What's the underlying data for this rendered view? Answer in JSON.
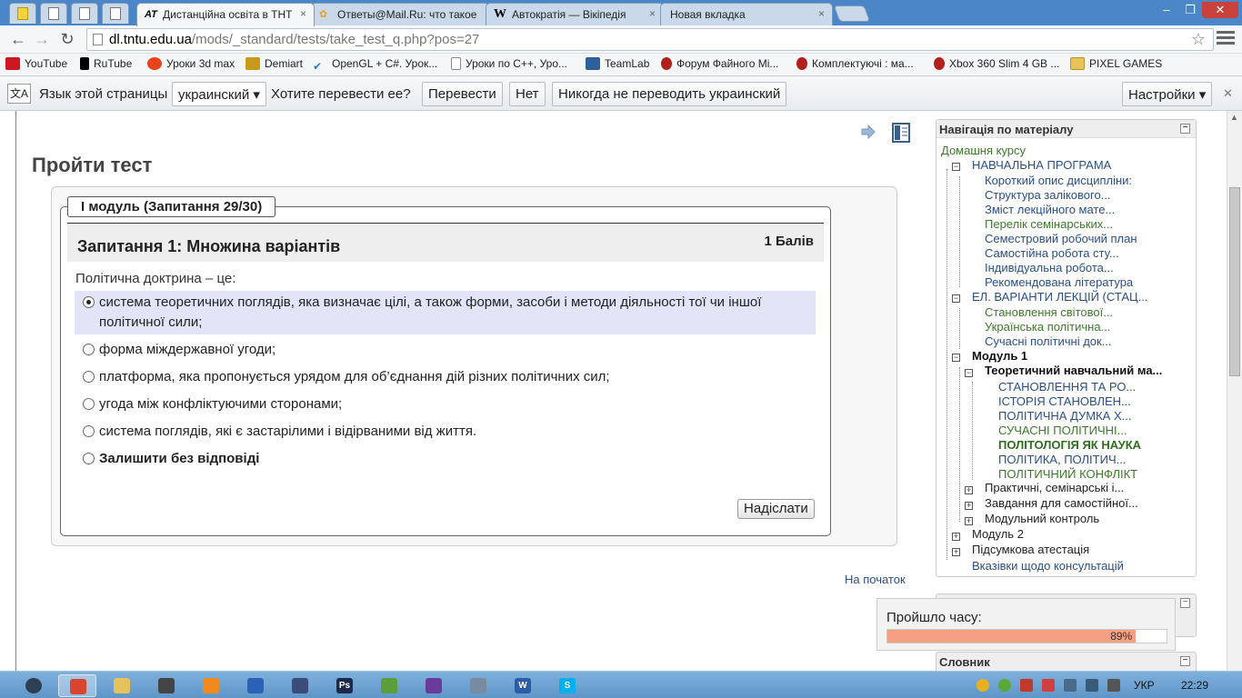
{
  "tabs": [
    {
      "title": "Дистанційна освіта в ТНТ",
      "icon": "AT",
      "active": true
    },
    {
      "title": "Ответы@Mail.Ru: что такое",
      "icon": "mailru-icon",
      "active": false
    },
    {
      "title": "Автократія — Вікіпедія",
      "icon": "W",
      "active": false
    },
    {
      "title": "Новая вкладка",
      "icon": "",
      "active": false
    }
  ],
  "tab_close": "×",
  "window_controls": {
    "minimize": "–",
    "restore": "❐",
    "close": "✕"
  },
  "address": {
    "host": "dl.tntu.edu.ua",
    "path": "/mods/_standard/tests/take_test_q.php?pos=27"
  },
  "nav_glyphs": {
    "back": "←",
    "forward": "→",
    "reload": "↻",
    "star": "☆"
  },
  "bookmarks": [
    {
      "label": "YouTube",
      "color": "#cc181e"
    },
    {
      "label": "RuTube",
      "color": "#000000"
    },
    {
      "label": "Уроки 3d max",
      "color": "#e8431c"
    },
    {
      "label": "Demiart",
      "color": "#c79a1a"
    },
    {
      "label": "OpenGL + C#. Урок...",
      "color": "#2a7ad6"
    },
    {
      "label": "Уроки по C++, Уро...",
      "color": "#ffffff"
    },
    {
      "label": "TeamLab",
      "color": "#2d5f9a"
    },
    {
      "label": "Форум Файного Мі...",
      "color": "#b3201c"
    },
    {
      "label": "Комплектуючі : ма...",
      "color": "#b3201c"
    },
    {
      "label": "Xbox 360 Slim 4 GB ...",
      "color": "#b3201c"
    },
    {
      "label": "PIXEL GAMES",
      "color": "#e8c35a"
    }
  ],
  "translate_bar": {
    "icon_label": "文A",
    "page_language_label": "Язык этой страницы",
    "language": "украинский ▾",
    "question": "Хотите перевести ее?",
    "translate": "Перевести",
    "no": "Нет",
    "never": "Никогда не переводить украинский",
    "settings": "Настройки ▾",
    "close": "✕"
  },
  "page": {
    "title": "Пройти тест",
    "module_legend": "І модуль (Запитання 29/30)",
    "question_title": "Запитання 1:   Множина варіантів",
    "grade": "1 Балів",
    "question_text": "Політична доктрина – це:",
    "answers": [
      {
        "text": "система теоретичних поглядів, яка визначає цілі, а також форми, засоби і методи діяльності тої чи іншої політичної сили;",
        "selected": true
      },
      {
        "text": "форма міждержавної угоди;",
        "selected": false
      },
      {
        "text": "платформа, яка пропонується урядом для об’єднання дій різних політичних сил;",
        "selected": false
      },
      {
        "text": "угода між конфліктуючими сторонами;",
        "selected": false
      },
      {
        "text": "система поглядів, які є застарілими і відірваними від життя.",
        "selected": false
      },
      {
        "text": "Залишити без відповіді",
        "selected": false
      }
    ],
    "submit": "Надіслати",
    "top_link": "На початок"
  },
  "nav": {
    "header": "Навігація по матеріалу",
    "items": [
      {
        "label": "Домашня курсу",
        "style": "green"
      },
      {
        "label": "НАВЧАЛЬНА ПРОГРАМА",
        "style": "link"
      },
      {
        "label": "Короткий опис дисципліни:",
        "style": "link"
      },
      {
        "label": "Структура залікового...",
        "style": "link"
      },
      {
        "label": "Зміст лекційного мате...",
        "style": "link"
      },
      {
        "label": "Перелік семінарських...",
        "style": "green"
      },
      {
        "label": "Семестровий робочий план",
        "style": "link"
      },
      {
        "label": "Самостійна робота сту...",
        "style": "link"
      },
      {
        "label": "Індивідуальна робота...",
        "style": "link"
      },
      {
        "label": "Рекомендована література",
        "style": "link"
      },
      {
        "label": "ЕЛ. ВАРІАНТИ ЛЕКЦІЙ (СТАЦ...",
        "style": "link"
      },
      {
        "label": "Становлення світової...",
        "style": "green"
      },
      {
        "label": "Українська політична...",
        "style": "green"
      },
      {
        "label": "Сучасні політичні док...",
        "style": "link"
      },
      {
        "label": "Модуль 1",
        "style": "black"
      },
      {
        "label": "Теоретичний навчальний ма...",
        "style": "black"
      },
      {
        "label": "СТАНОВЛЕННЯ ТА РО...",
        "style": "link"
      },
      {
        "label": "ІСТОРІЯ СТАНОВЛЕН...",
        "style": "link"
      },
      {
        "label": "ПОЛІТИЧНА ДУМКА Х...",
        "style": "link"
      },
      {
        "label": "СУЧАСНІ ПОЛІТИЧНІ...",
        "style": "green"
      },
      {
        "label": "ПОЛІТОЛОГІЯ ЯК НАУКА",
        "style": "greenbold"
      },
      {
        "label": "ПОЛІТИКА, ПОЛІТИЧ...",
        "style": "link"
      },
      {
        "label": "ПОЛІТИЧНИЙ КОНФЛІКТ",
        "style": "green"
      },
      {
        "label": "Практичні, семінарські і...",
        "style": "plain"
      },
      {
        "label": "Завдання для самостійної...",
        "style": "plain"
      },
      {
        "label": "Модульний контроль",
        "style": "plain"
      },
      {
        "label": "Модуль 2",
        "style": "plain"
      },
      {
        "label": "Підсумкова атестація",
        "style": "plain"
      },
      {
        "label": "Вказівки щодо консультацій",
        "style": "link"
      }
    ],
    "expanders": {
      "minus": "−",
      "plus": "+"
    }
  },
  "glossary_header": "Словник",
  "timer": {
    "label": "Пройшло часу:",
    "progress_text": "89%",
    "progress": 0.89
  },
  "taskbar": {
    "language": "УКР",
    "time": "22:29",
    "apps": [
      {
        "name": "chrome",
        "color": "#d9442f",
        "label": ""
      },
      {
        "name": "explorer",
        "color": "#e6c25a",
        "label": ""
      },
      {
        "name": "movie-maker",
        "color": "#444444",
        "label": ""
      },
      {
        "name": "media-player",
        "color": "#f08a1c",
        "label": ""
      },
      {
        "name": "visual-studio",
        "color": "#2a62b8",
        "label": ""
      },
      {
        "name": "app-infinity",
        "color": "#3c4c7a",
        "label": ""
      },
      {
        "name": "photoshop",
        "color": "#1b2a4a",
        "label": "Ps"
      },
      {
        "name": "app-green",
        "color": "#5c9e3a",
        "label": ""
      },
      {
        "name": "app-purple",
        "color": "#6a3c9a",
        "label": ""
      },
      {
        "name": "calculator",
        "color": "#7a8aa0",
        "label": ""
      },
      {
        "name": "word",
        "color": "#2b5ca8",
        "label": "W"
      },
      {
        "name": "skype",
        "color": "#00aff0",
        "label": "S"
      }
    ]
  },
  "colors": {
    "accent_link": "#2a4f88",
    "green_link": "#3c7a2a",
    "selected_answer_bg": "#e2e4f7",
    "timer_fill": "#f79f82"
  }
}
